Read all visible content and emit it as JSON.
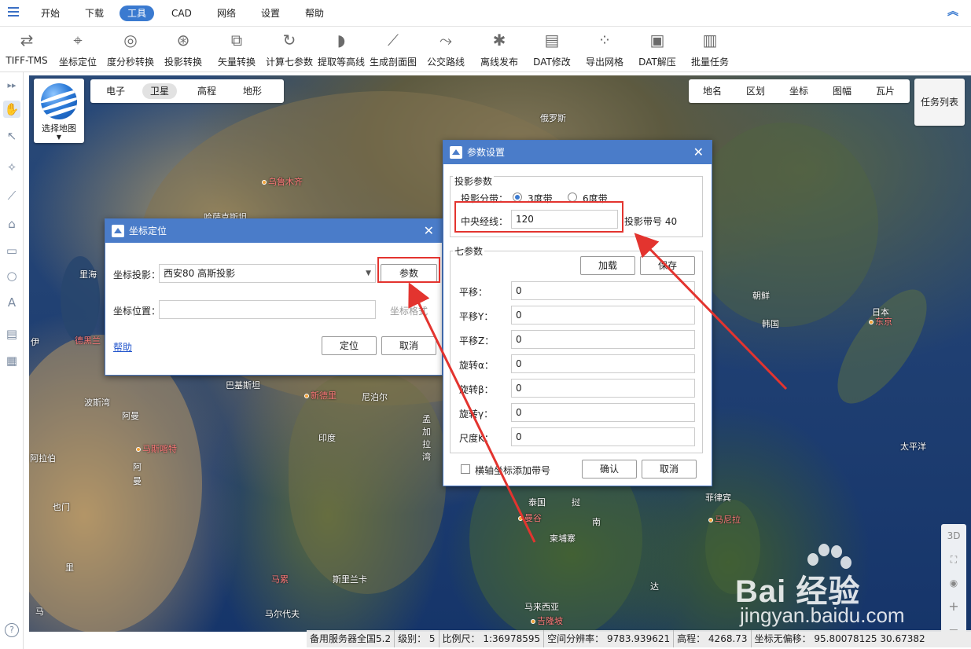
{
  "menu": {
    "items": [
      "开始",
      "下载",
      "工具",
      "CAD",
      "网络",
      "设置",
      "帮助"
    ],
    "active": "工具"
  },
  "toolbar": {
    "tools": [
      {
        "label": "TIFF-TMS",
        "icon": "tiff-tms-icon",
        "glyph": "⇄"
      },
      {
        "label": "坐标定位",
        "icon": "crosshair-icon",
        "glyph": "⌖"
      },
      {
        "label": "度分秒转换",
        "icon": "dms-convert-icon",
        "glyph": "◎"
      },
      {
        "label": "投影转换",
        "icon": "projection-icon",
        "glyph": "⊛"
      },
      {
        "label": "矢量转换",
        "icon": "vector-convert-icon",
        "glyph": "⧉"
      },
      {
        "label": "计算七参数",
        "icon": "seven-params-icon",
        "glyph": "↻"
      },
      {
        "label": "提取等高线",
        "icon": "contour-icon",
        "glyph": "◗"
      },
      {
        "label": "生成剖面图",
        "icon": "profile-icon",
        "glyph": "⟋"
      },
      {
        "label": "公交路线",
        "icon": "bus-route-icon",
        "glyph": "⤳"
      },
      {
        "label": "离线发布",
        "icon": "offline-publish-icon",
        "glyph": "✱"
      },
      {
        "label": "DAT修改",
        "icon": "dat-edit-icon",
        "glyph": "▤"
      },
      {
        "label": "导出网格",
        "icon": "export-grid-icon",
        "glyph": "⁘"
      },
      {
        "label": "DAT解压",
        "icon": "dat-unzip-icon",
        "glyph": "▣"
      },
      {
        "label": "批量任务",
        "icon": "batch-task-icon",
        "glyph": "▥"
      }
    ]
  },
  "map_controls": {
    "select_map": "选择地图",
    "layer_tabs": [
      "电子",
      "卫星",
      "高程",
      "地形"
    ],
    "active_layer": "卫星",
    "overlay_tabs": [
      "地名",
      "区划",
      "坐标",
      "图幅",
      "瓦片"
    ],
    "task_list": "任务列表",
    "side": [
      "3D",
      "⛶",
      "◉",
      "+",
      "−"
    ]
  },
  "map_labels": {
    "russia": "俄罗斯",
    "urumqi": "乌鲁木齐",
    "kazakhstan": "哈萨克斯坦",
    "caspian": "里海",
    "tehran": "德黑兰",
    "pakistan": "巴基斯坦",
    "new_delhi": "新德里",
    "nepal": "尼泊尔",
    "persian_gulf": "波斯湾",
    "oman": "阿曼",
    "muscat": "马斯喀特",
    "saudi": "阿拉伯",
    "yemen": "也门",
    "oman_sea": "阿\n曼",
    "india": "印度",
    "bangladesh": "孟\n加\n拉\n湾",
    "thailand": "泰国",
    "bangkok": "曼谷",
    "laos": "挝",
    "cambodia": "柬埔寨",
    "vietnam": "南",
    "philippines": "菲律宾",
    "manila": "马尼拉",
    "sri_lanka": "斯里兰卡",
    "male": "马累",
    "maldives": "马尔代夫",
    "malaysia": "马来西亚",
    "kuala_lumpur": "吉隆坡",
    "north_korea": "朝鲜",
    "south_korea": "韩国",
    "japan": "日本",
    "tokyo": "东京",
    "pacific": "太平洋",
    "da": "达",
    "ma": "马",
    "li": "里",
    "kashi": "伊"
  },
  "status": {
    "server": "备用服务器全国5.2",
    "level": "级别： 5",
    "scale": "比例尺： 1:36978595",
    "resolution": "空间分辨率： 9783.939621",
    "elevation": "高程：  4268.73",
    "coord": "坐标无偏移：       95.80078125    30.67382"
  },
  "dialog_locate": {
    "title": "坐标定位",
    "projection_label": "坐标投影：",
    "projection_value": "西安80 高斯投影",
    "params_button": "参数",
    "position_label": "坐标位置：",
    "position_value": "",
    "format_link": "坐标格式",
    "help_link": "帮助",
    "locate_button": "定位",
    "cancel_button": "取消"
  },
  "dialog_params": {
    "title": "参数设置",
    "projection_group": "投影参数",
    "zone_label": "投影分带：",
    "zone_3": "3度带",
    "zone_6": "6度带",
    "zone_selected": "3度带",
    "meridian_label": "中央经线：",
    "meridian_value": "120",
    "zone_number": "投影带号  40",
    "seven_group": "七参数",
    "load_button": "加载",
    "save_button": "保存",
    "params": [
      {
        "label": "平移：",
        "value": "0"
      },
      {
        "label": "平移Y：",
        "value": "0"
      },
      {
        "label": "平移Z：",
        "value": "0"
      },
      {
        "label": "旋转α：",
        "value": "0"
      },
      {
        "label": "旋转β：",
        "value": "0"
      },
      {
        "label": "旋转γ：",
        "value": "0"
      },
      {
        "label": "尺度K：",
        "value": "0"
      }
    ],
    "add_zone_checkbox": "横轴坐标添加带号",
    "confirm_button": "确认",
    "cancel_button": "取消"
  },
  "watermark": {
    "brand": "Bai 经验",
    "url": "jingyan.baidu.com"
  },
  "colors": {
    "accent": "#3a7ad0",
    "dialog_title": "#4a7cc9",
    "annotation": "#e3342f"
  }
}
